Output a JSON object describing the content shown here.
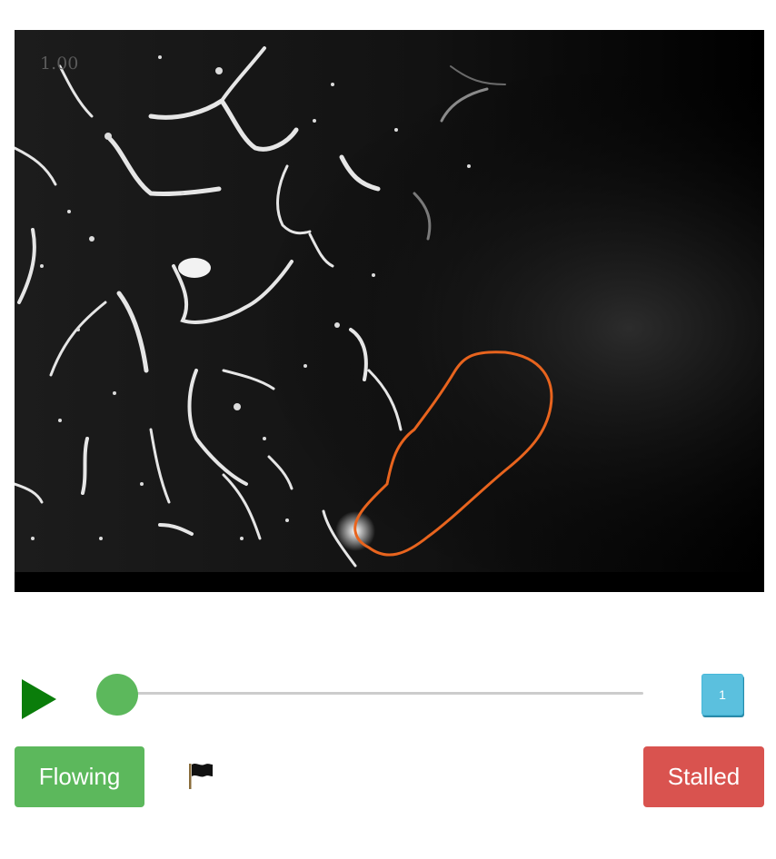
{
  "video": {
    "frame_counter": "1.00",
    "outline_color": "#e8641e"
  },
  "controls": {
    "play_icon": "play-icon",
    "play_color": "#0a7d0a",
    "slider_value": 0,
    "slider_color": "#5cb85c",
    "frame_number": "1"
  },
  "actions": {
    "flowing_label": "Flowing",
    "flowing_color": "#5cb85c",
    "flag_icon": "flag-icon",
    "stalled_label": "Stalled",
    "stalled_color": "#d9534f"
  }
}
